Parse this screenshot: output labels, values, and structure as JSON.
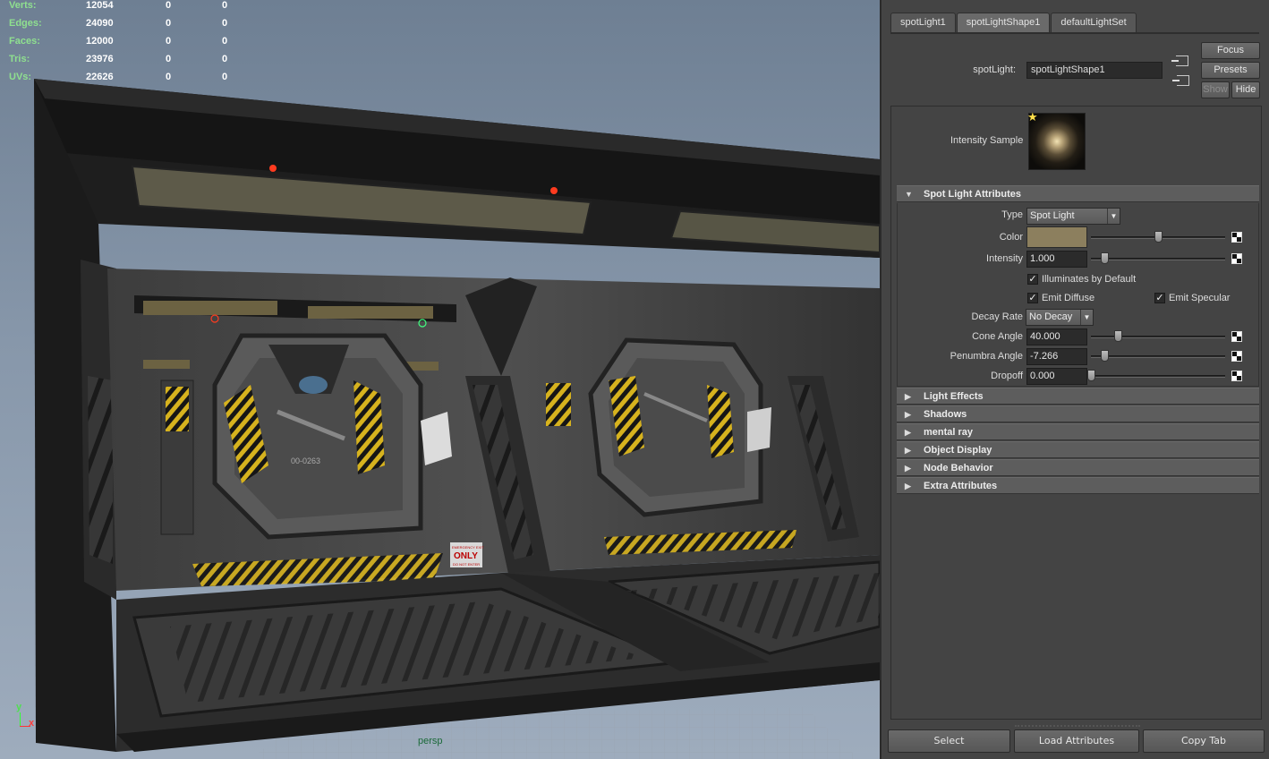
{
  "viewport": {
    "stats": [
      {
        "label": "Verts:",
        "values": [
          "12054",
          "0",
          "0"
        ]
      },
      {
        "label": "Edges:",
        "values": [
          "24090",
          "0",
          "0"
        ]
      },
      {
        "label": "Faces:",
        "values": [
          "12000",
          "0",
          "0"
        ]
      },
      {
        "label": "Tris:",
        "values": [
          "23976",
          "0",
          "0"
        ]
      },
      {
        "label": "UVs:",
        "values": [
          "22626",
          "0",
          "0"
        ]
      }
    ],
    "axis": {
      "y": "y",
      "x": "x"
    },
    "camera_label": "persp",
    "scene_decals": {
      "door_code": "00-0263",
      "sign_top": "EMERGENCY EXIT",
      "sign_main": "ONLY",
      "sign_bottom": "DO NOT ENTER"
    }
  },
  "attribute_editor": {
    "tabs": [
      "spotLight1",
      "spotLightShape1",
      "defaultLightSet"
    ],
    "active_tab": "spotLightShape1",
    "node_label": "spotLight:",
    "node_value": "spotLightShape1",
    "buttons": {
      "focus": "Focus",
      "presets": "Presets",
      "show": "Show",
      "hide": "Hide"
    },
    "sample_label": "Intensity Sample",
    "sections": {
      "spot_light": "Spot Light Attributes",
      "light_effects": "Light Effects",
      "shadows": "Shadows",
      "mental_ray": "mental ray",
      "object_display": "Object Display",
      "node_behavior": "Node Behavior",
      "extra_attributes": "Extra Attributes"
    },
    "attrs": {
      "type_label": "Type",
      "type_value": "Spot Light",
      "color_label": "Color",
      "color_value": "#8c7f5e",
      "color_slider": 0.5,
      "intensity_label": "Intensity",
      "intensity_value": "1.000",
      "intensity_slider": 0.1,
      "illuminates_label": "Illuminates by Default",
      "illuminates_checked": true,
      "emit_diffuse_label": "Emit Diffuse",
      "emit_diffuse_checked": true,
      "emit_specular_label": "Emit Specular",
      "emit_specular_checked": true,
      "decay_label": "Decay Rate",
      "decay_value": "No Decay",
      "cone_label": "Cone Angle",
      "cone_value": "40.000",
      "cone_slider": 0.2,
      "penumbra_label": "Penumbra Angle",
      "penumbra_value": "-7.266",
      "penumbra_slider": 0.1,
      "dropoff_label": "Dropoff",
      "dropoff_value": "0.000",
      "dropoff_slider": 0.0
    },
    "footer": {
      "select": "Select",
      "load": "Load Attributes",
      "copy": "Copy Tab"
    }
  }
}
